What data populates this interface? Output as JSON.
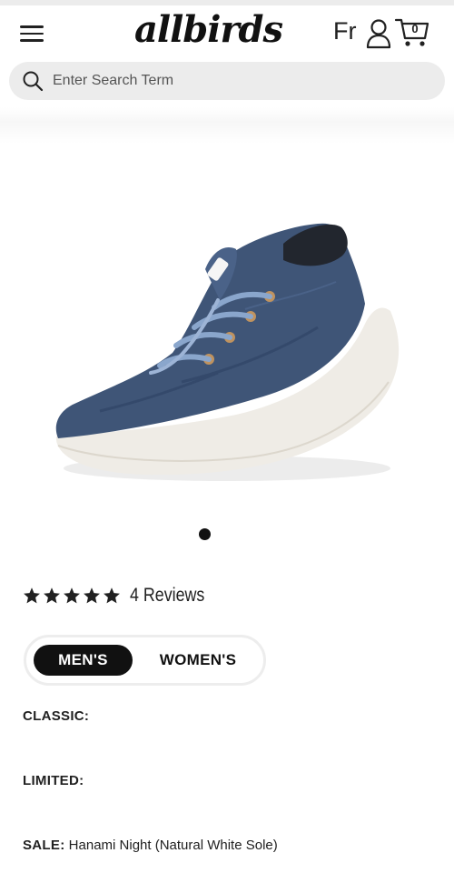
{
  "header": {
    "brand": "allbirds",
    "language": "Fr",
    "cart_count": "0",
    "icons": {
      "menu": "hamburger-menu-icon",
      "account": "user-icon",
      "cart": "shopping-cart-icon",
      "search": "search-icon"
    }
  },
  "search": {
    "placeholder": "Enter Search Term"
  },
  "product": {
    "image": "blue-knit-sneaker-white-sole",
    "colors": {
      "upper": "#3f5577",
      "sole": "#efece6",
      "laces": "#8aa6cc",
      "eyelets": "#c0935f"
    },
    "carousel": {
      "current_slide": 1,
      "total_slides": 1
    },
    "rating": {
      "stars": 5,
      "reviews_label": "4 Reviews"
    }
  },
  "gender_toggle": {
    "options": [
      "MEN'S",
      "WOMEN'S"
    ],
    "selected": "MEN'S"
  },
  "variants": {
    "classic_label": "CLASSIC:",
    "classic_value": "",
    "limited_label": "LIMITED:",
    "limited_value": "",
    "sale_label": "SALE:",
    "sale_value": "Hanami Night (Natural White Sole)"
  }
}
